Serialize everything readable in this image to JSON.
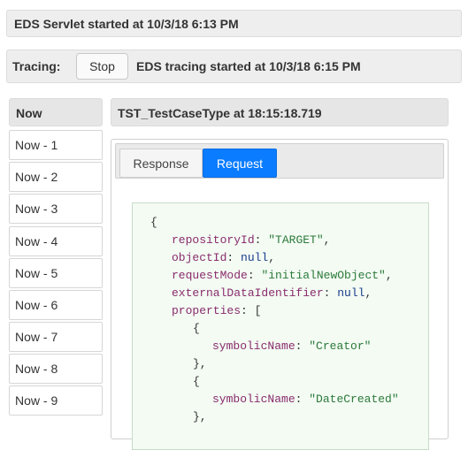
{
  "status": {
    "text": "EDS Servlet started at 10/3/18 6:13 PM"
  },
  "tracing": {
    "label": "Tracing:",
    "stop_button": "Stop",
    "message": "EDS tracing started at 10/3/18 6:15 PM"
  },
  "list": {
    "header": "Now",
    "items": [
      "Now - 1",
      "Now - 2",
      "Now - 3",
      "Now - 4",
      "Now - 5",
      "Now - 6",
      "Now - 7",
      "Now - 8",
      "Now - 9"
    ]
  },
  "detail": {
    "header": "TST_TestCaseType at 18:15:18.719",
    "tabs": [
      {
        "label": "Response",
        "active": false
      },
      {
        "label": "Request",
        "active": true
      }
    ],
    "code": {
      "open_brace": "{",
      "repositoryId_key": "repositoryId",
      "repositoryId_val": "\"TARGET\"",
      "objectId_key": "objectId",
      "objectId_val": "null",
      "requestMode_key": "requestMode",
      "requestMode_val": "\"initialNewObject\"",
      "externalDataIdentifier_key": "externalDataIdentifier",
      "externalDataIdentifier_val": "null",
      "properties_key": "properties",
      "properties_open": "[",
      "obj_open": "{",
      "symbolicName_key": "symbolicName",
      "prop1_val": "\"Creator\"",
      "obj_close": "},",
      "prop2_val": "\"DateCreated\""
    }
  },
  "colors": {
    "accent": "#0a7cff",
    "code_background": "#f3fbf3",
    "key_color": "#8a2c6c",
    "string_color": "#2c7a3a",
    "null_color": "#1a3c8c"
  }
}
